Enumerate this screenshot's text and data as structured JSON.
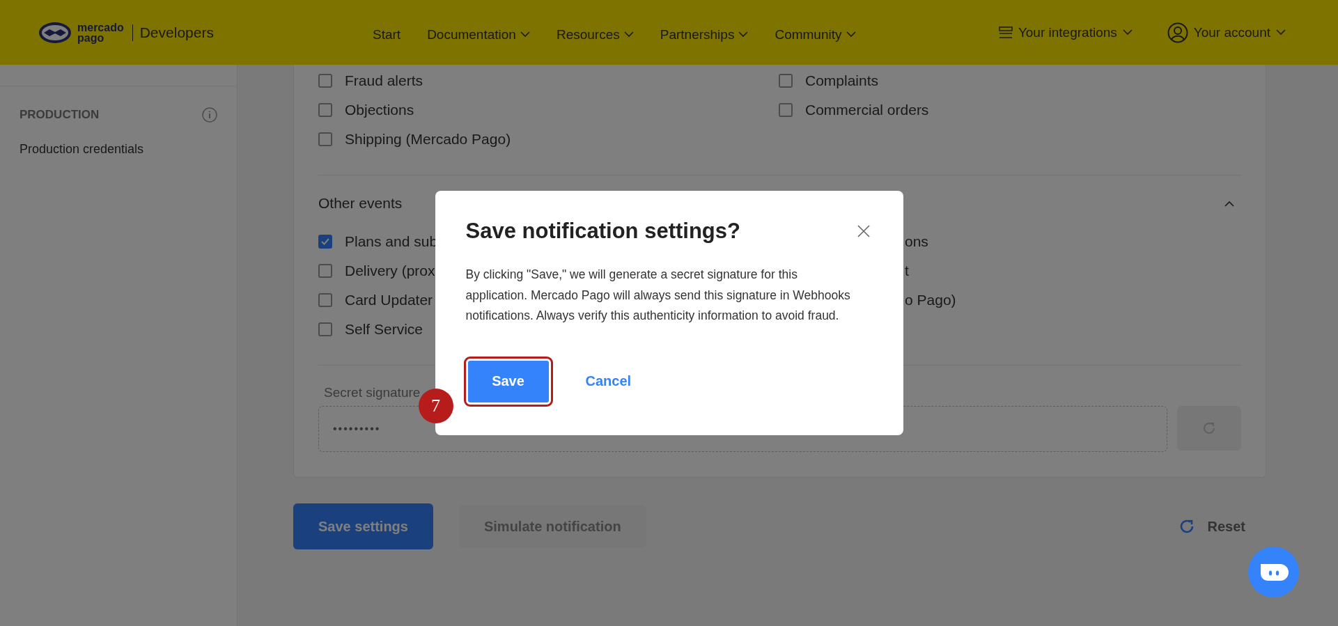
{
  "header": {
    "logo_lines": [
      "mercado",
      "pago"
    ],
    "brand": "Developers",
    "nav": [
      {
        "label": "Start",
        "dropdown": false
      },
      {
        "label": "Documentation",
        "dropdown": true
      },
      {
        "label": "Resources",
        "dropdown": true
      },
      {
        "label": "Partnerships",
        "dropdown": true
      },
      {
        "label": "Community",
        "dropdown": true
      }
    ],
    "integrations": "Your integrations",
    "account": "Your account"
  },
  "sidebar": {
    "section": "PRODUCTION",
    "items": [
      "Production credentials"
    ]
  },
  "events": {
    "left": [
      {
        "label": "Fraud alerts",
        "checked": false
      },
      {
        "label": "Objections",
        "checked": false
      },
      {
        "label": "Shipping (Mercado Pago)",
        "checked": false
      }
    ],
    "right": [
      {
        "label": "Complaints",
        "checked": false
      },
      {
        "label": "Commercial orders",
        "checked": false
      }
    ]
  },
  "other_events": {
    "title": "Other events",
    "expanded": true,
    "left": [
      {
        "label": "Plans and sub",
        "checked": true
      },
      {
        "label": "Delivery (prox",
        "checked": false
      },
      {
        "label": "Card Updater",
        "checked": false
      },
      {
        "label": "Self Service",
        "checked": false
      }
    ],
    "right": [
      "ons",
      "t",
      "o Pago)"
    ]
  },
  "secret": {
    "label": "Secret signature",
    "value": "•••••••••"
  },
  "actions": {
    "save": "Save settings",
    "simulate": {
      "label": "Simulate notification",
      "disabled": true
    },
    "reset": "Reset"
  },
  "dialog": {
    "title": "Save notification settings?",
    "body": "By clicking \"Save,\" we will generate a secret signature for this application. Mercado Pago will always send this signature in Webhooks notifications. Always verify this authenticity information to avoid fraud.",
    "confirm": "Save",
    "cancel": "Cancel",
    "step": "7"
  }
}
